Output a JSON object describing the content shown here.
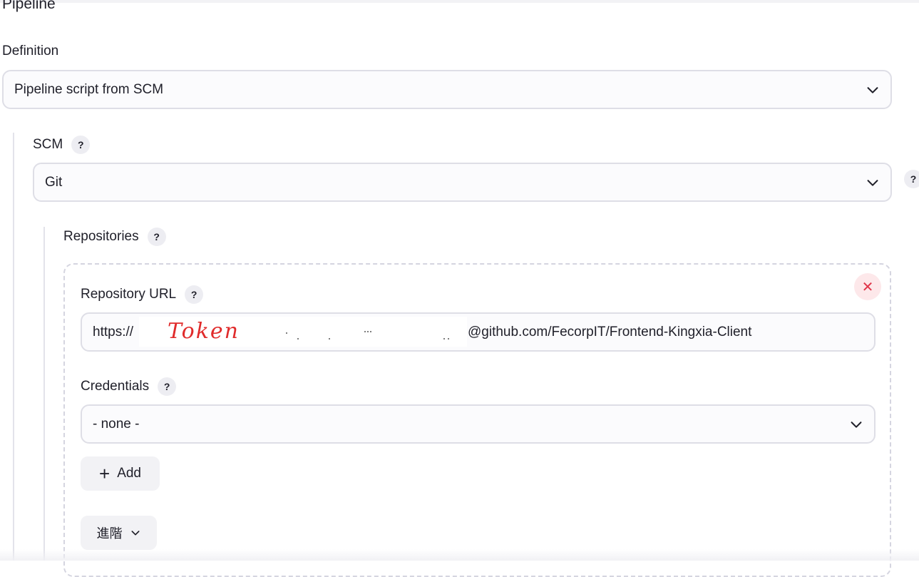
{
  "section": {
    "title": "Pipeline"
  },
  "definition": {
    "label": "Definition",
    "selected": "Pipeline script from SCM"
  },
  "scm": {
    "label": "SCM",
    "help": "?",
    "selected": "Git",
    "side_help": "?"
  },
  "repositories": {
    "label": "Repositories",
    "help": "?",
    "delete_icon": "✕",
    "repository_url": {
      "label": "Repository URL",
      "help": "?",
      "value_prefix": "https://",
      "annotation": "Token",
      "value_suffix": "@github.com/FecorpIT/Frontend-Kingxia-Client"
    },
    "credentials": {
      "label": "Credentials",
      "help": "?",
      "selected": "- none -"
    },
    "add_button": {
      "icon": "+",
      "label": "Add"
    },
    "advanced_button": {
      "label": "進階"
    }
  },
  "colors": {
    "accent_delete": "#e0364a",
    "annotation": "#e02b2b"
  }
}
